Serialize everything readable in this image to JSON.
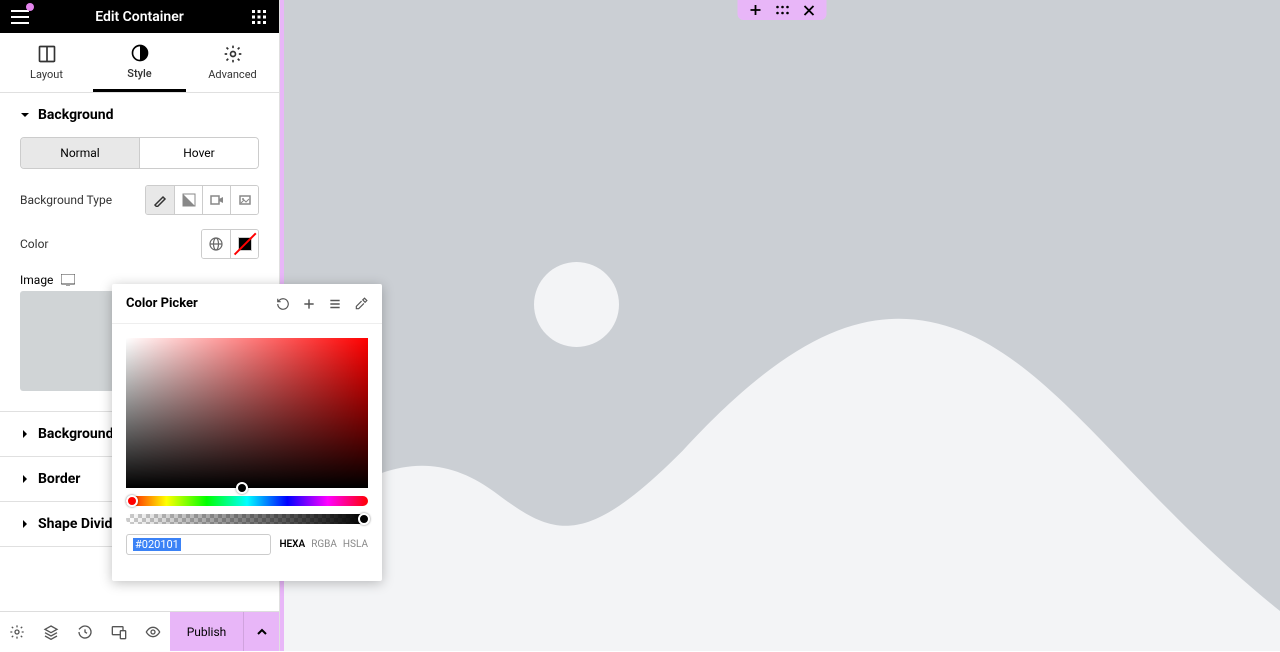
{
  "header": {
    "title": "Edit Container"
  },
  "tabs": {
    "layout": "Layout",
    "style": "Style",
    "advanced": "Advanced",
    "active": "Style"
  },
  "sections": {
    "background": {
      "title": "Background"
    },
    "background_overlay": {
      "title": "Background Overlay"
    },
    "border": {
      "title": "Border"
    },
    "shape_divider": {
      "title": "Shape Divider"
    }
  },
  "state_tabs": {
    "normal": "Normal",
    "hover": "Hover",
    "active": "Normal"
  },
  "labels": {
    "background_type": "Background Type",
    "color": "Color",
    "image": "Image"
  },
  "color_picker": {
    "title": "Color Picker",
    "hex_value": "#020101",
    "formats": {
      "hexa": "HEXA",
      "rgba": "RGBA",
      "hsla": "HSLA",
      "active": "HEXA"
    }
  },
  "footer": {
    "publish": "Publish"
  },
  "canvas_pill": {
    "add": "+",
    "drag": "⠿",
    "close": "✕"
  }
}
